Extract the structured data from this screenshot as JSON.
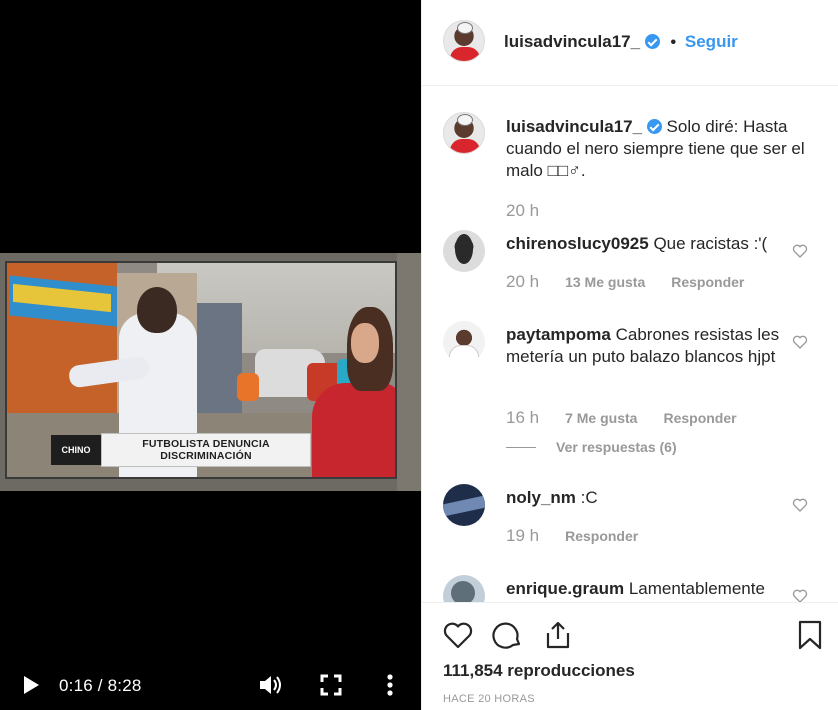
{
  "video": {
    "lower_third_text": "FUTBOLISTA DENUNCIA DISCRIMINACIÓN",
    "show_logo_text": "CHINO",
    "time_display": "0:16 / 8:28"
  },
  "header": {
    "username": "luisadvincula17_",
    "separator": "•",
    "follow_label": "Seguir"
  },
  "caption": {
    "username": "luisadvincula17_",
    "text": "Solo diré: Hasta cuando el nero siempre tiene que ser el malo □□♂.",
    "time": "20 h"
  },
  "comments": [
    {
      "username": "chirenoslucy0925",
      "text": "Que racistas :'(",
      "time": "20 h",
      "likes": "13 Me gusta",
      "reply_label": "Responder"
    },
    {
      "username": "paytampoma",
      "text": "Cabrones resistas les metería un puto balazo blancos hjpt",
      "time": "16 h",
      "likes": "7 Me gusta",
      "reply_label": "Responder",
      "view_replies": "Ver respuestas (6)"
    },
    {
      "username": "noly_nm",
      "text": ":C",
      "time": "19 h",
      "reply_label": "Responder"
    },
    {
      "username": "enrique.graum",
      "text": "Lamentablemente"
    }
  ],
  "footer": {
    "views": "111,854 reproducciones",
    "posted_ago": "HACE 20 HORAS"
  },
  "colors": {
    "link_blue": "#3897f0",
    "text_dark": "#262626",
    "text_muted": "#999999",
    "border": "#efefef"
  }
}
